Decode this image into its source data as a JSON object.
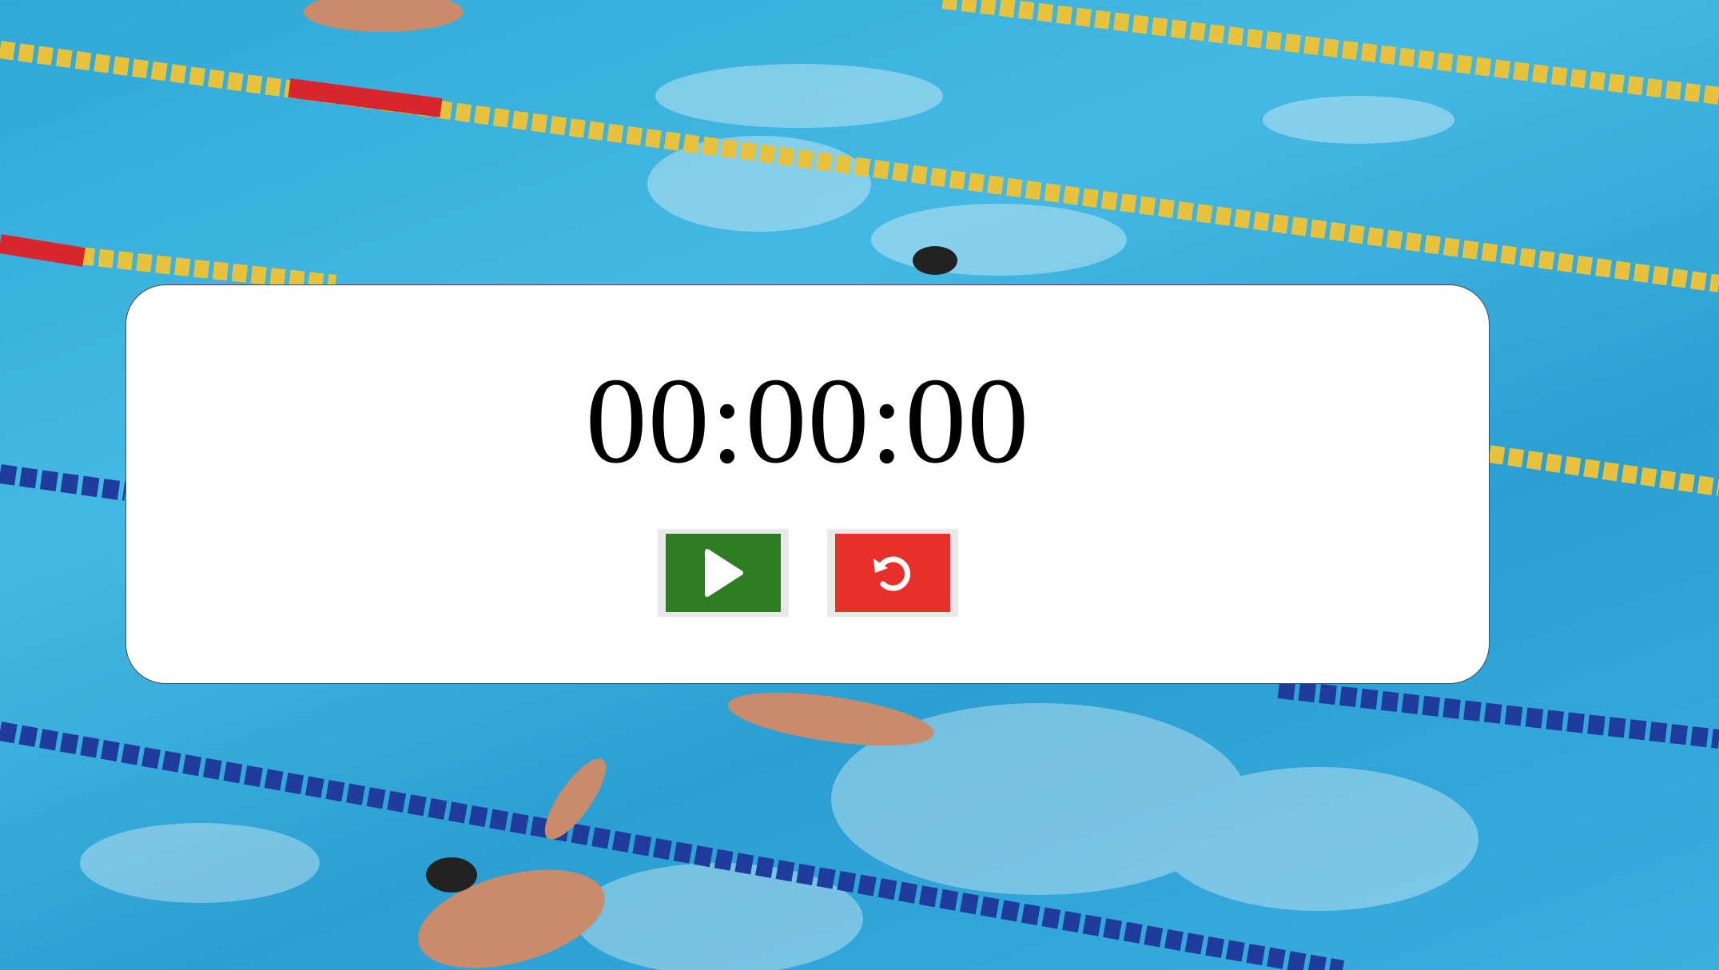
{
  "background": {
    "image": "swimming-pool-race",
    "water_color": "#3aaedf",
    "lane_colors": [
      "#e8c23c",
      "#d9262e",
      "#1f3c9c"
    ]
  },
  "stopwatch": {
    "time_display": "00:00:00",
    "play_button": {
      "icon": "play-icon",
      "color": "#2f7d23"
    },
    "reset_button": {
      "icon": "reset-icon",
      "color": "#e8302a"
    }
  }
}
